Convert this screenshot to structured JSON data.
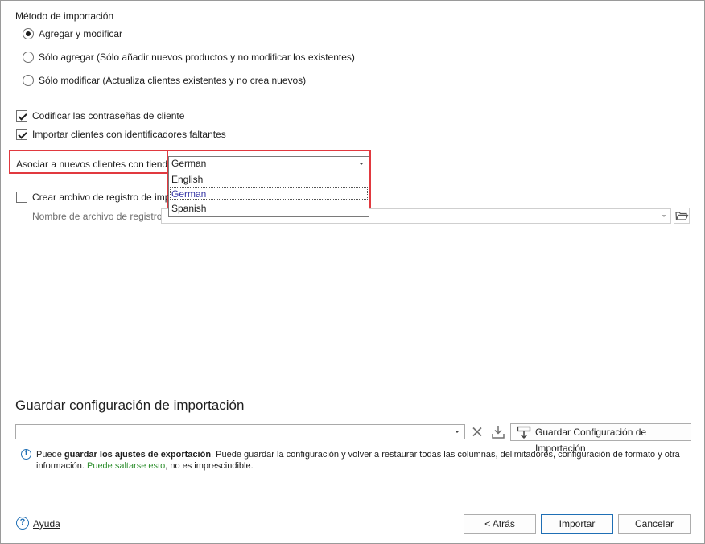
{
  "import_method": {
    "label": "Método de importación",
    "options": [
      {
        "label": "Agregar y modificar",
        "selected": true
      },
      {
        "label": "Sólo agregar (Sólo añadir nuevos productos y no modificar los existentes)",
        "selected": false
      },
      {
        "label": "Sólo modificar (Actualiza clientes existentes y no crea nuevos)",
        "selected": false
      }
    ]
  },
  "options": {
    "encode_passwords": {
      "label": "Codificar las contraseñas de cliente",
      "checked": true
    },
    "import_missing_ids": {
      "label": "Importar clientes con identificadores faltantes",
      "checked": true
    }
  },
  "store": {
    "label": "Asociar a nuevos clientes con tienda",
    "selected": "German",
    "dropdown_options": [
      "English",
      "German",
      "Spanish"
    ],
    "highlighted_option": "German"
  },
  "log": {
    "create_label": "Crear archivo de registro de import",
    "filename_label": "Nombre de archivo de registro",
    "filename_value": ""
  },
  "save_config": {
    "title": "Guardar configuración de importación",
    "input_value": "",
    "save_button": "Guardar Configuración de Importación",
    "info_pre": "Puede ",
    "info_bold": "guardar los ajustes de exportación",
    "info_mid": ". Puede guardar la configuración y volver a restaurar todas las columnas, delimitadores, configuración de formato y otra información. ",
    "info_green": "Puede saltarse esto",
    "info_post": ", no es imprescindible."
  },
  "footer": {
    "help": "Ayuda",
    "back": "< Atrás",
    "import": "Importar",
    "cancel": "Cancelar"
  },
  "colors": {
    "highlight_border": "#e1393f",
    "dropdown_selected_text": "#3a3aa8",
    "info_icon": "#1f6fb5",
    "green_text": "#2f8f2f"
  }
}
